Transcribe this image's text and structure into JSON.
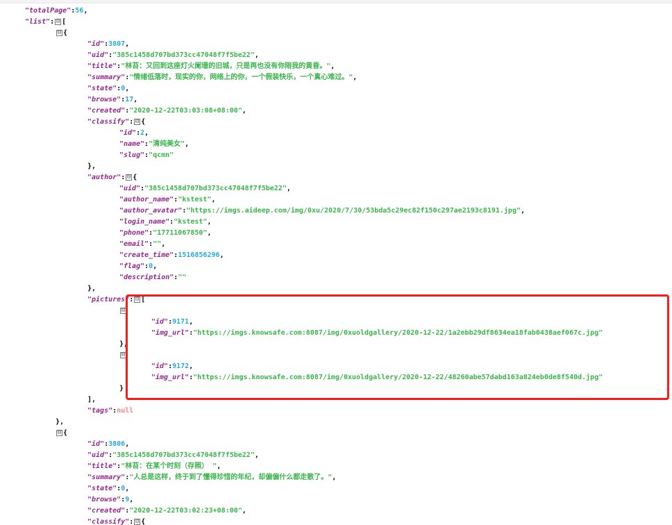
{
  "toggle_glyph": "⊟",
  "colors": {
    "key": "#92278f",
    "string": "#3ab54a",
    "number": "#25aae2",
    "null": "#f98280",
    "highlight": "#ff1a1a"
  },
  "json": {
    "totalPage": {
      "key": "\"totalPage\"",
      "value": "56"
    },
    "list": {
      "key": "\"list\""
    },
    "items": [
      {
        "id": {
          "key": "\"id\"",
          "value": "3807"
        },
        "uid": {
          "key": "\"uid\"",
          "value": "\"385c1458d707bd373cc47048f7f5be22\""
        },
        "title": {
          "key": "\"title\"",
          "value": "\"林苔：又回到这座灯火阑珊的旧城，只是再也没有你陪我的黄昏。\""
        },
        "summary": {
          "key": "\"summary\"",
          "value": "\"情绪低落时，现实的你，网络上的你，一个假装快乐，一个真心难过。\""
        },
        "state": {
          "key": "\"state\"",
          "value": "0"
        },
        "browse": {
          "key": "\"browse\"",
          "value": "17"
        },
        "created": {
          "key": "\"created\"",
          "value": "\"2020-12-22T03:03:08+08:00\""
        },
        "classify": {
          "key": "\"classify\"",
          "id": {
            "key": "\"id\"",
            "value": "2"
          },
          "name": {
            "key": "\"name\"",
            "value": "\"清纯美女\""
          },
          "slug": {
            "key": "\"slug\"",
            "value": "\"qcmn\""
          }
        },
        "author": {
          "key": "\"author\"",
          "uid": {
            "key": "\"uid\"",
            "value": "\"385c1458d707bd373cc47048f7f5be22\""
          },
          "author_name": {
            "key": "\"author_name\"",
            "value": "\"kstest\""
          },
          "author_avatar": {
            "key": "\"author_avatar\"",
            "value": "\"https://imgs.aideep.com/img/0xu/2020/7/30/53bda5c29ec82f150c297ae2193c8191.jpg\""
          },
          "login_name": {
            "key": "\"login_name\"",
            "value": "\"kstest\""
          },
          "phone": {
            "key": "\"phone\"",
            "value": "\"17711067850\""
          },
          "email": {
            "key": "\"email\"",
            "value": "\"\""
          },
          "create_time": {
            "key": "\"create_time\"",
            "value": "1516856296"
          },
          "flag": {
            "key": "\"flag\"",
            "value": "0"
          },
          "description": {
            "key": "\"description\"",
            "value": "\"\""
          }
        },
        "pictures": {
          "key": "\"pictures\"",
          "items": [
            {
              "id": {
                "key": "\"id\"",
                "value": "9171"
              },
              "img_url": {
                "key": "\"img_url\"",
                "value": "\"https://imgs.knowsafe.com:8087/img/0xuoldgallery/2020-12-22/1a2ebb29df8634ea18fab0438aef067c.jpg\""
              }
            },
            {
              "id": {
                "key": "\"id\"",
                "value": "9172"
              },
              "img_url": {
                "key": "\"img_url\"",
                "value": "\"https://imgs.knowsafe.com:8087/img/0xuoldgallery/2020-12-22/48260abe57dabd163a824eb0de8f540d.jpg\""
              }
            }
          ]
        },
        "tags": {
          "key": "\"tags\"",
          "value": "null"
        }
      },
      {
        "id": {
          "key": "\"id\"",
          "value": "3806"
        },
        "uid": {
          "key": "\"uid\"",
          "value": "\"385c1458d707bd373cc47048f7f5be22\""
        },
        "title": {
          "key": "\"title\"",
          "value": "\"林苔：在某个时刻（存照）  \""
        },
        "summary": {
          "key": "\"summary\"",
          "value": "\"人总是这样，终于到了懂得珍惜的年纪，却偏偏什么都走散了。\""
        },
        "state": {
          "key": "\"state\"",
          "value": "0"
        },
        "browse": {
          "key": "\"browse\"",
          "value": "9"
        },
        "created": {
          "key": "\"created\"",
          "value": "\"2020-12-22T03:02:23+08:00\""
        },
        "classify": {
          "key": "\"classify\""
        }
      }
    ]
  }
}
